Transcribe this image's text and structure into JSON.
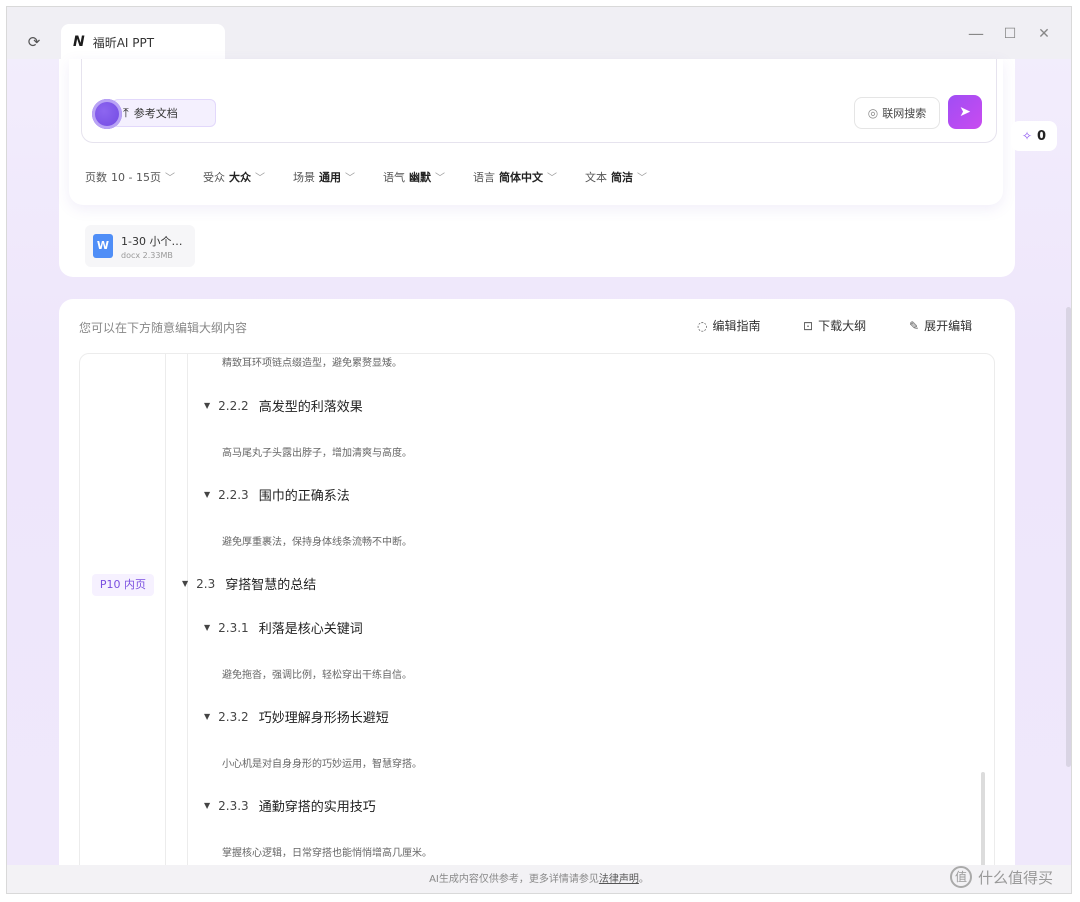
{
  "app": {
    "tab_logo": "N",
    "tab_title": "福昕AI PPT"
  },
  "window_controls": {
    "minimize": "—",
    "maximize": "☐",
    "close": "✕"
  },
  "input": {
    "ref_doc_label": "参考文档",
    "web_search_label": "联网搜索"
  },
  "options": [
    {
      "label": "页数",
      "value": "10 - 15页"
    },
    {
      "label": "受众",
      "value": "大众"
    },
    {
      "label": "场景",
      "value": "通用"
    },
    {
      "label": "语气",
      "value": "幽默"
    },
    {
      "label": "语言",
      "value": "简体中文"
    },
    {
      "label": "文本",
      "value": "简洁"
    }
  ],
  "file": {
    "name": "1-30 小个…",
    "meta": "docx 2.33MB",
    "icon": "W"
  },
  "score": {
    "value": "0"
  },
  "outline": {
    "hint": "您可以在下方随意编辑大纲内容",
    "actions": {
      "guide": "编辑指南",
      "download": "下载大纲",
      "expand": "展开编辑"
    },
    "page_tag": "P10 内页",
    "rows": [
      {
        "type": "desc",
        "text": "精致耳环项链点缀造型，避免累赘显矮。"
      },
      {
        "type": "h3",
        "num": "2.2.2",
        "title": "高发型的利落效果"
      },
      {
        "type": "desc",
        "text": "高马尾丸子头露出脖子，增加清爽与高度。"
      },
      {
        "type": "h3",
        "num": "2.2.3",
        "title": "围巾的正确系法"
      },
      {
        "type": "desc",
        "text": "避免厚重裹法，保持身体线条流畅不中断。"
      },
      {
        "type": "h2",
        "num": "2.3",
        "title": "穿搭智慧的总结"
      },
      {
        "type": "h3",
        "num": "2.3.1",
        "title": "利落是核心关键词"
      },
      {
        "type": "desc",
        "text": "避免拖沓，强调比例，轻松穿出干练自信。"
      },
      {
        "type": "h3",
        "num": "2.3.2",
        "title": "巧妙理解身形扬长避短"
      },
      {
        "type": "desc",
        "text": "小心机是对自身身形的巧妙运用，智慧穿搭。"
      },
      {
        "type": "h3",
        "num": "2.3.3",
        "title": "通勤穿搭的实用技巧"
      },
      {
        "type": "desc",
        "text": "掌握核心逻辑，日常穿搭也能悄悄增高几厘米。"
      }
    ]
  },
  "footer": {
    "text": "AI生成内容仅供参考，更多详情请参见",
    "link": "法律声明",
    "suffix": "。"
  },
  "watermark": {
    "logo": "值",
    "text": "什么值得买"
  }
}
